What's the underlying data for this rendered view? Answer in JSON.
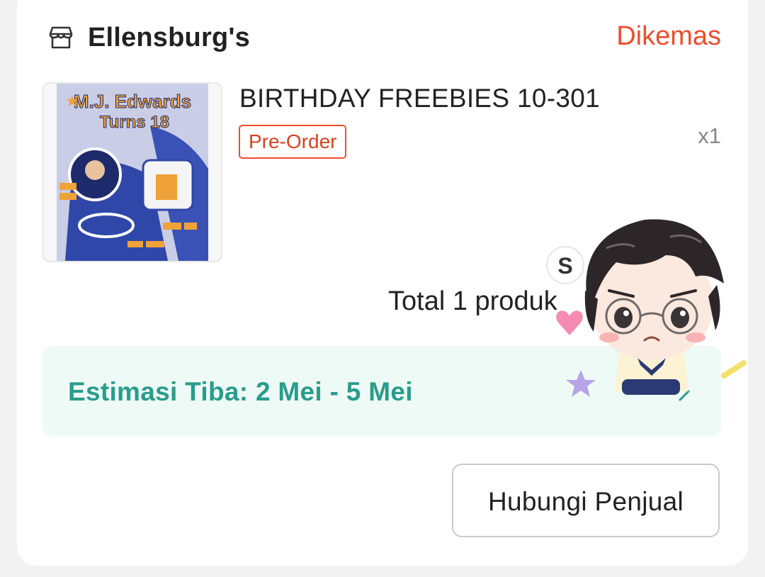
{
  "shop": {
    "name": "Ellensburg's",
    "icon": "store-icon",
    "status": "Dikemas"
  },
  "product": {
    "title": "BIRTHDAY FREEBIES 10-301",
    "badge": "Pre-Order",
    "quantity": "x1",
    "image_text": {
      "line1": "M.J. Edwards",
      "line2": "Turns 18"
    }
  },
  "summary": {
    "total": "Total 1 produk"
  },
  "shipping": {
    "estimate": "Estimasi Tiba: 2 Mei - 5 Mei",
    "chevron_icon": "chevron-right-icon"
  },
  "actions": {
    "contact_label": "Hubungi Penjual"
  },
  "overlay": {
    "sticker_badge": "S"
  },
  "colors": {
    "accent": "#ee4d2d",
    "eta_text": "#2a9c8b",
    "eta_bg": "#eefaf6"
  }
}
